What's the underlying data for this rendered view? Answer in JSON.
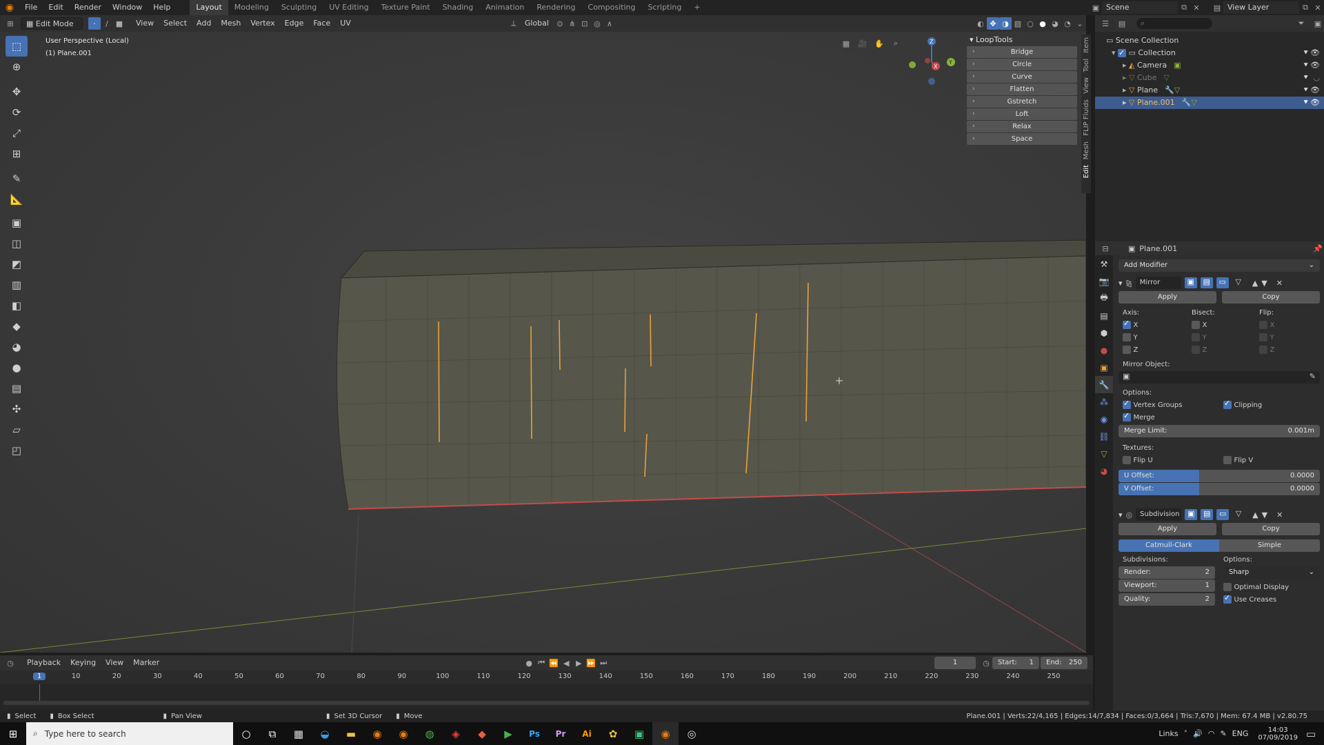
{
  "menu": {
    "items": [
      "File",
      "Edit",
      "Render",
      "Window",
      "Help"
    ],
    "workspaces": [
      "Layout",
      "Modeling",
      "Sculpting",
      "UV Editing",
      "Texture Paint",
      "Shading",
      "Animation",
      "Rendering",
      "Compositing",
      "Scripting"
    ],
    "active_workspace": "Layout",
    "scene_label": "Scene",
    "view_layer_label": "View Layer"
  },
  "vp_header": {
    "mode": "Edit Mode",
    "menus": [
      "View",
      "Select",
      "Add",
      "Mesh",
      "Vertex",
      "Edge",
      "Face",
      "UV"
    ],
    "orientation": "Global"
  },
  "viewport": {
    "perspective": "User Perspective (Local)",
    "object": "(1) Plane.001"
  },
  "looptools": {
    "title": "LoopTools",
    "items": [
      "Bridge",
      "Circle",
      "Curve",
      "Flatten",
      "Gstretch",
      "Loft",
      "Relax",
      "Space"
    ]
  },
  "side_tabs": [
    "Item",
    "Tool",
    "View",
    "FLIP Fluids",
    "Mesh",
    "Edit"
  ],
  "outliner": {
    "root": "Scene Collection",
    "collection": "Collection",
    "objects": [
      "Camera",
      "Cube",
      "Plane",
      "Plane.001"
    ]
  },
  "properties": {
    "object_name": "Plane.001",
    "add_modifier": "Add Modifier",
    "mirror": {
      "name": "Mirror",
      "apply": "Apply",
      "copy": "Copy",
      "axis_label": "Axis:",
      "bisect_label": "Bisect:",
      "flip_label": "Flip:",
      "axes": [
        "X",
        "Y",
        "Z"
      ],
      "mirror_object_label": "Mirror Object:",
      "options_label": "Options:",
      "vertex_groups": "Vertex Groups",
      "clipping": "Clipping",
      "merge": "Merge",
      "merge_limit_label": "Merge Limit:",
      "merge_limit_value": "0.001m",
      "textures_label": "Textures:",
      "flip_u": "Flip U",
      "flip_v": "Flip V",
      "u_offset_label": "U Offset:",
      "u_offset_value": "0.0000",
      "v_offset_label": "V Offset:",
      "v_offset_value": "0.0000"
    },
    "subdivision": {
      "name": "Subdivision",
      "apply": "Apply",
      "copy": "Copy",
      "catmull": "Catmull-Clark",
      "simple": "Simple",
      "subdivisions_label": "Subdivisions:",
      "options_label": "Options:",
      "render_label": "Render:",
      "render_value": "2",
      "viewport_label": "Viewport:",
      "viewport_value": "1",
      "quality_label": "Quality:",
      "quality_value": "2",
      "uv_smooth": "Sharp",
      "optimal_display": "Optimal Display",
      "use_creases": "Use Creases"
    }
  },
  "timeline": {
    "menus": [
      "Playback",
      "Keying",
      "View",
      "Marker"
    ],
    "current_frame": "1",
    "start_label": "Start:",
    "start_value": "1",
    "end_label": "End:",
    "end_value": "250",
    "ticks": [
      "1",
      "10",
      "20",
      "30",
      "40",
      "50",
      "60",
      "70",
      "80",
      "90",
      "100",
      "110",
      "120",
      "130",
      "140",
      "150",
      "160",
      "170",
      "180",
      "190",
      "200",
      "210",
      "220",
      "230",
      "240",
      "250"
    ]
  },
  "statusbar": {
    "select": "Select",
    "box_select": "Box Select",
    "pan_view": "Pan View",
    "set_cursor": "Set 3D Cursor",
    "move": "Move",
    "stats": "Plane.001 | Verts:22/4,165 | Edges:14/7,834 | Faces:0/3,664 | Tris:7,670 | Mem: 67.4 MB | v2.80.75"
  },
  "taskbar": {
    "search_placeholder": "Type here to search",
    "links": "Links",
    "lang": "ENG",
    "time": "14:03",
    "date": "07/09/2019"
  },
  "colors": {
    "accent": "#4772b3",
    "selected_row": "#3d5c8f",
    "edge_highlight": "#e8a33a",
    "x_axis": "#c44c4c",
    "y_axis": "#8bb33a"
  }
}
